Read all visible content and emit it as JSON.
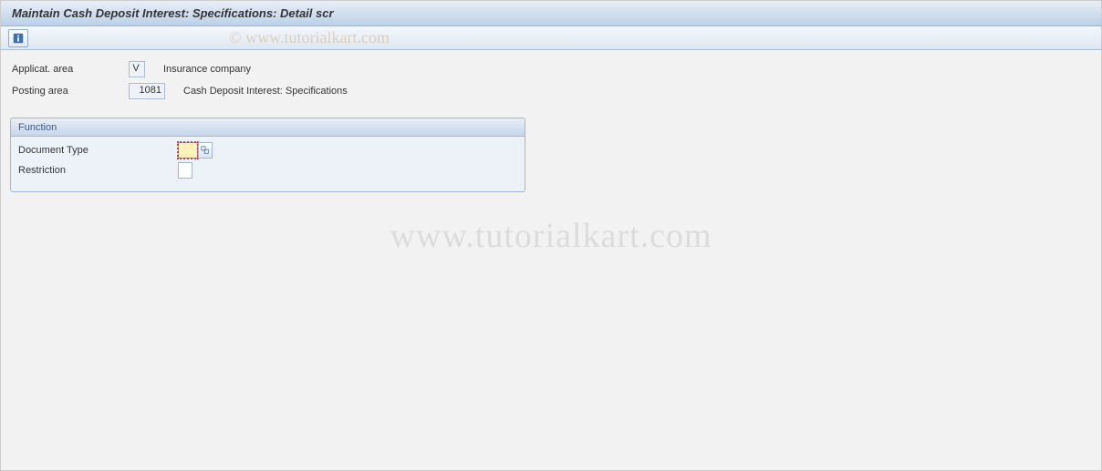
{
  "header": {
    "title": "Maintain Cash Deposit Interest: Specifications: Detail scr"
  },
  "toolbar": {
    "info_icon": "info-icon"
  },
  "fields": {
    "applicat_area": {
      "label": "Applicat. area",
      "value": "V",
      "desc": "Insurance company"
    },
    "posting_area": {
      "label": "Posting area",
      "value": "1081",
      "desc": "Cash Deposit Interest: Specifications"
    }
  },
  "group": {
    "title": "Function",
    "document_type": {
      "label": "Document Type",
      "value": ""
    },
    "restriction": {
      "label": "Restriction",
      "value": ""
    }
  },
  "watermark": {
    "main": "www.tutorialkart.com",
    "top": "© www.tutorialkart.com"
  }
}
